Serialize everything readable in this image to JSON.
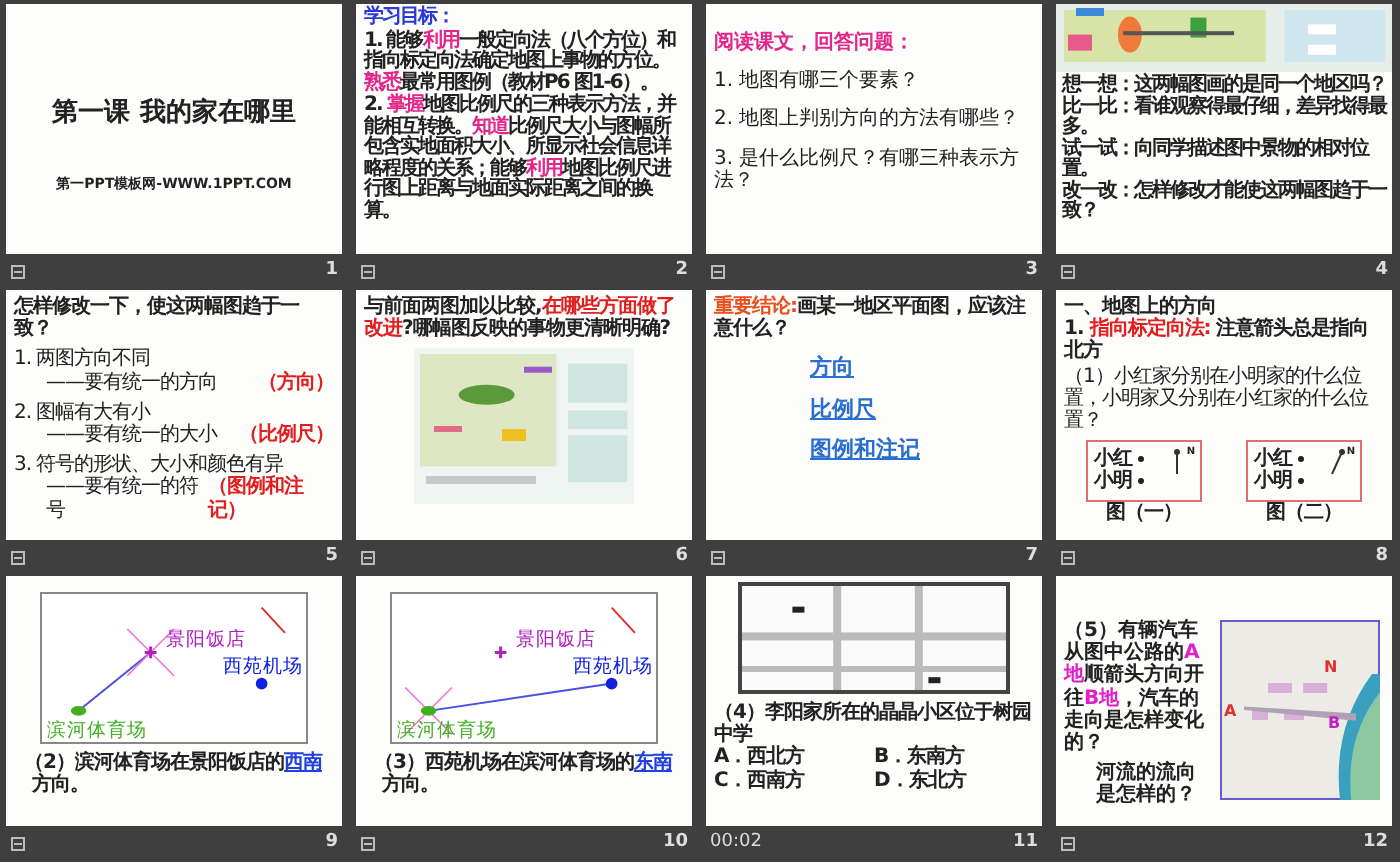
{
  "slides": [
    {
      "number": "1",
      "transition": true,
      "kind": "title",
      "title": "第一课  我的家在哪里",
      "credit": "第一PPT模板网-WWW.1PPT.COM"
    },
    {
      "number": "2",
      "transition": true,
      "kind": "goals",
      "heading": "学习目标：",
      "paragraphs": [
        "1. 能够**利用**一般定向法（八个方位）和指向标定向法确定地图上事物的方位。**熟悉**最常用图例（教材P6 图1-6）。",
        "2. **掌握**地图比例尺的三种表示方法，并能相互转换。**知道**比例尺大小与图幅所包含实地面积大小、所显示社会信息详略程度的关系；能够**利用**地图比例尺进行图上距离与地面实际距离之间的换算。"
      ]
    },
    {
      "number": "3",
      "transition": true,
      "kind": "questions",
      "heading": "阅读课文，回答问题：",
      "items": [
        "1. 地图有哪三个要素？",
        "2. 地图上判别方向的方法有哪些？",
        "3. 是什么比例尺？有哪三种表示方法？"
      ]
    },
    {
      "number": "4",
      "transition": true,
      "kind": "picture_lines",
      "lines": [
        "想一想：这两幅图画的是同一个地区吗？",
        "比一比：看谁观察得最仔细，差异找得最多。",
        "试一试：向同学描述图中景物的相对位置。",
        "改一改：怎样修改才能使这两幅图趋于一致？"
      ]
    },
    {
      "number": "5",
      "transition": true,
      "kind": "answers",
      "heading": "怎样修改一下，使这两幅图趋于一致？",
      "items": [
        {
          "line": "1. 两图方向不同",
          "sub": "——要有统一的方向",
          "answer": "（方向）"
        },
        {
          "line": "2. 图幅有大有小",
          "sub": "——要有统一的大小",
          "answer": "（比例尺）"
        },
        {
          "line": "3. 符号的形状、大小和颜色有异",
          "sub": "——要有统一的符号",
          "answer": "（图例和注记）"
        }
      ]
    },
    {
      "number": "6",
      "transition": true,
      "kind": "compare",
      "heading": "与前面两图加以比较,**在哪些方面做了改进**?哪幅图反映的事物更清晰明确?"
    },
    {
      "number": "7",
      "transition": true,
      "kind": "conclusion",
      "heading": "**重要结论:**画某一地区平面图，应该注意什么？",
      "links": [
        "方向",
        "比例尺",
        "图例和注记"
      ]
    },
    {
      "number": "8",
      "transition": true,
      "kind": "direction",
      "heading": "一、地图上的方向",
      "method": "1. **指向标定向法:** 注意箭头总是指向北方",
      "question": "（1）小红家分别在小明家的什么位置，小明家又分别在小红家的什么位置？",
      "figures": [
        {
          "labels": [
            "小红",
            "小明"
          ],
          "kind": "vertical",
          "north": "N",
          "caption": "图（一）"
        },
        {
          "labels": [
            "小红",
            "小明"
          ],
          "kind": "diagonal",
          "north": "N",
          "caption": "图（二）"
        }
      ]
    },
    {
      "number": "9",
      "transition": true,
      "kind": "diagram",
      "places": [
        {
          "label": "景阳饭店",
          "kind": "cross",
          "arrow_start": false,
          "arrow_end": true,
          "compass": true
        },
        {
          "label": "西苑机场",
          "kind": "dot",
          "arrow_start": false,
          "arrow_end": false,
          "compass": false
        },
        {
          "label": "滨河体育场",
          "kind": "oval",
          "arrow_start": true,
          "arrow_end": false,
          "compass": false
        }
      ],
      "question": "（2）滨河体育场在景阳饭店的",
      "answer": "西南",
      "question_end": "方向。"
    },
    {
      "number": "10",
      "transition": true,
      "kind": "diagram",
      "places": [
        {
          "label": "景阳饭店",
          "kind": "cross",
          "arrow_start": false,
          "arrow_end": false,
          "compass": false
        },
        {
          "label": "西苑机场",
          "kind": "dot",
          "arrow_start": false,
          "arrow_end": true,
          "compass": false
        },
        {
          "label": "滨河体育场",
          "kind": "oval",
          "arrow_start": true,
          "arrow_end": false,
          "compass": true
        }
      ],
      "question": "（3）西苑机场在滨河体育场的",
      "answer": "东南",
      "question_end": "方向。"
    },
    {
      "number": "11",
      "transition": false,
      "timing": "00:02",
      "kind": "quiz",
      "question": "（4）李阳家所在的晶晶小区位于树园中学",
      "options": [
        "A．西北方",
        "B．东南方",
        "C．西南方",
        "D．东北方"
      ]
    },
    {
      "number": "12",
      "transition": true,
      "kind": "car",
      "question": "（5）有辆汽车从图中公路的**A地**顺箭头方向开往**B地**，汽车的走向是怎样变化的？",
      "river": "河流的流向是怎样的？",
      "points": [
        "N",
        "A",
        "B"
      ]
    }
  ]
}
